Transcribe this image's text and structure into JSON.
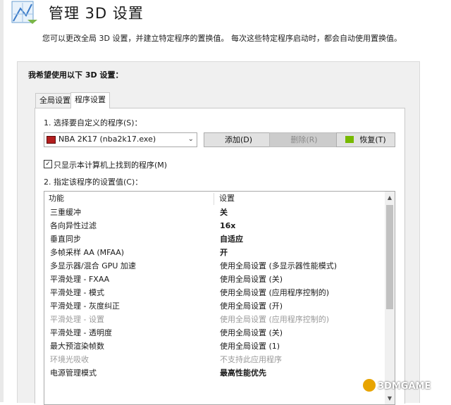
{
  "header": {
    "title": "管理 3D 设置",
    "description": "您可以更改全局 3D 设置，并建立特定程序的置换值。 每次这些特定程序启动时，都会自动使用置换值。"
  },
  "panel": {
    "heading": "我希望使用以下 3D 设置：",
    "tabs": [
      {
        "label": "全局设置",
        "selected": false
      },
      {
        "label": "程序设置",
        "selected": true
      }
    ]
  },
  "program": {
    "select_label": "1. 选择要自定义的程序(S)：",
    "selected_program": "NBA 2K17 (nba2k17.exe)",
    "add_button": "添加(D)",
    "remove_button": "删除(R)",
    "restore_button": "恢复(T)",
    "checkbox_label": "只显示本计算机上找到的程序(M)",
    "checkbox_checked": true,
    "settings_label": "2. 指定该程序的设置值(C)："
  },
  "table": {
    "headers": {
      "feature": "功能",
      "setting": "设置"
    },
    "rows": [
      {
        "feature": "三重缓冲",
        "setting": "关",
        "bold": true,
        "dim": false
      },
      {
        "feature": "各向异性过滤",
        "setting": "16x",
        "bold": true,
        "dim": false
      },
      {
        "feature": "垂直同步",
        "setting": "自适应",
        "bold": true,
        "dim": false
      },
      {
        "feature": "多帧采样 AA (MFAA)",
        "setting": "开",
        "bold": true,
        "dim": false
      },
      {
        "feature": "多显示器/混合 GPU 加速",
        "setting": "使用全局设置 (多显示器性能模式)",
        "bold": false,
        "dim": false
      },
      {
        "feature": "平滑处理 - FXAA",
        "setting": "使用全局设置 (关)",
        "bold": false,
        "dim": false
      },
      {
        "feature": "平滑处理 - 模式",
        "setting": "使用全局设置 (应用程序控制的)",
        "bold": false,
        "dim": false
      },
      {
        "feature": "平滑处理 - 灰度纠正",
        "setting": "使用全局设置 (开)",
        "bold": false,
        "dim": false
      },
      {
        "feature": "平滑处理 - 设置",
        "setting": "使用全局设置 (应用程序控制的)",
        "bold": false,
        "dim": true
      },
      {
        "feature": "平滑处理 - 透明度",
        "setting": "使用全局设置 (关)",
        "bold": false,
        "dim": false
      },
      {
        "feature": "最大预渲染帧数",
        "setting": "使用全局设置 (1)",
        "bold": false,
        "dim": false
      },
      {
        "feature": "环境光吸收",
        "setting": "不支持此应用程序",
        "bold": false,
        "dim": true
      },
      {
        "feature": "电源管理模式",
        "setting": "最高性能优先",
        "bold": true,
        "dim": false
      }
    ]
  },
  "watermark": "3DMGAME",
  "colors": {
    "nvidia_green": "#77b900",
    "panel_bg": "#f0f0f0"
  }
}
